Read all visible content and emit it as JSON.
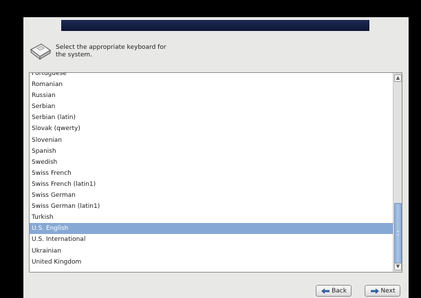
{
  "header": {
    "prompt": "Select the appropriate keyboard for\nthe system.",
    "icon": "keyboard-icon"
  },
  "keyboard_list": {
    "items": [
      "Portuguese",
      "Romanian",
      "Russian",
      "Serbian",
      "Serbian (latin)",
      "Slovak (qwerty)",
      "Slovenian",
      "Spanish",
      "Swedish",
      "Swiss French",
      "Swiss French (latin1)",
      "Swiss German",
      "Swiss German (latin1)",
      "Turkish",
      "U.S. English",
      "U.S. International",
      "Ukrainian",
      "United Kingdom"
    ],
    "selected": "U.S. English"
  },
  "buttons": {
    "back_label": "Back",
    "next_label": "Next"
  },
  "colors": {
    "selection": "#86a8d4",
    "banner": "#14204a",
    "arrow": "#2f5f9e"
  }
}
